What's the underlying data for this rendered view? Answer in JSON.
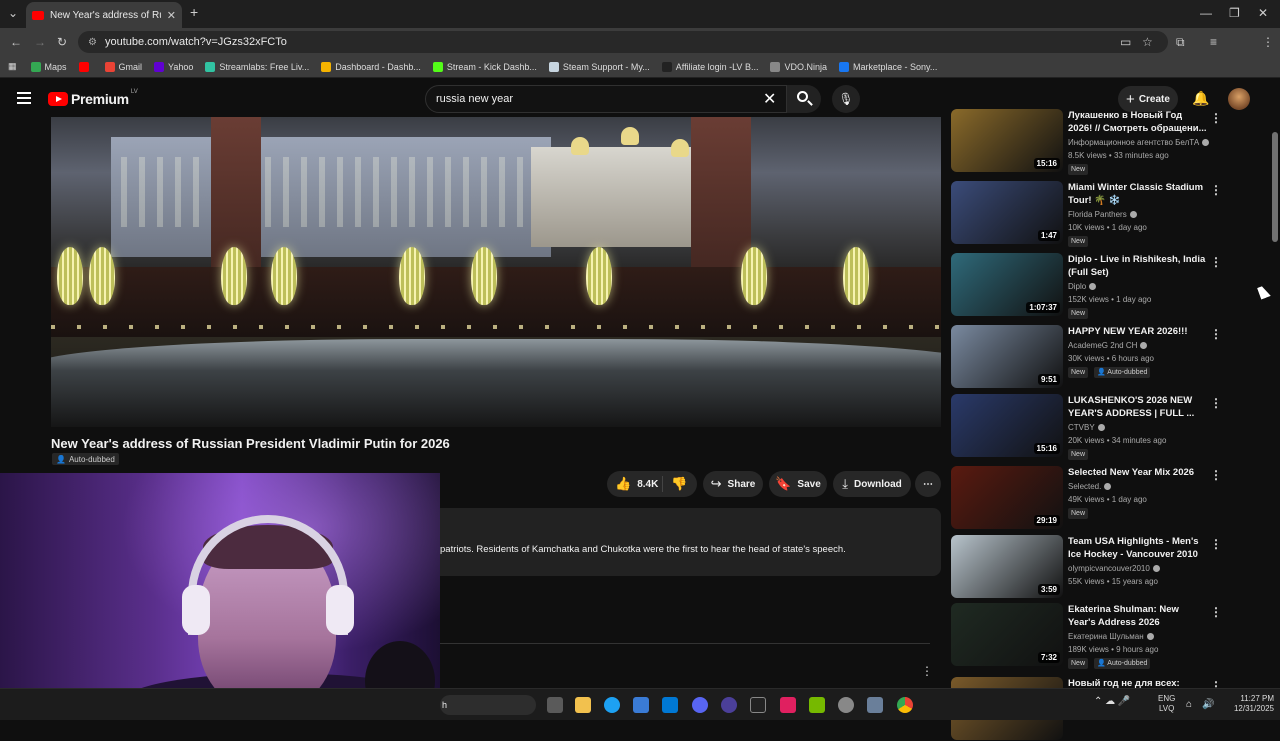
{
  "browser": {
    "tab_title": "New Year's address of Russian P",
    "url": "youtube.com/watch?v=JGzs32xFCTo",
    "bookmarks": [
      {
        "label": "Maps",
        "color": "#34a853"
      },
      {
        "label": "",
        "color": "#ff0000"
      },
      {
        "label": "Gmail",
        "color": "#ea4335"
      },
      {
        "label": "Yahoo",
        "color": "#6001d2"
      },
      {
        "label": "Streamlabs: Free Liv...",
        "color": "#31c3a2"
      },
      {
        "label": "Dashboard - Dashb...",
        "color": "#f5b300"
      },
      {
        "label": "Stream - Kick Dashb...",
        "color": "#53fc18"
      },
      {
        "label": "Steam Support - My...",
        "color": "#c7d5e0"
      },
      {
        "label": "Affiliate login -LV B...",
        "color": "#222222"
      },
      {
        "label": "VDO.Ninja",
        "color": "#888888"
      },
      {
        "label": "Marketplace - Sony...",
        "color": "#1877f2"
      }
    ]
  },
  "youtube": {
    "logo_text": "Premium",
    "country_code": "LV",
    "search_value": "russia new year",
    "create_label": "Create"
  },
  "video": {
    "title": "New Year's address of Russian President Vladimir Putin for 2026",
    "dub_label": "Auto-dubbed",
    "likes": "8.4K",
    "share_label": "Share",
    "save_label": "Save",
    "download_label": "Download",
    "description_snippet": "patriots. Residents of Kamchatka and Chukotka were the first to hear the head of state's speech."
  },
  "recommendations": [
    {
      "title": "Лукашенко в Новый Год 2026! // Смотреть обращени...",
      "channel": "Информационное агентство БелТА",
      "verified": true,
      "views": "8.5K views",
      "age": "33 minutes ago",
      "badge": "New",
      "badge2": "",
      "duration": "15:16",
      "thumb": "#8a6a2a"
    },
    {
      "title": "Miami Winter Classic Stadium Tour! 🌴 ❄️",
      "channel": "Florida Panthers",
      "verified": true,
      "views": "10K views",
      "age": "1 day ago",
      "badge": "New",
      "badge2": "",
      "duration": "1:47",
      "thumb": "#3b4c7a"
    },
    {
      "title": "Diplo - Live in Rishikesh, India (Full Set)",
      "channel": "Diplo",
      "verified": true,
      "views": "152K views",
      "age": "1 day ago",
      "badge": "New",
      "badge2": "",
      "duration": "1:07:37",
      "thumb": "#2f6a7a"
    },
    {
      "title": "HAPPY NEW YEAR 2026!!!",
      "channel": "AcademeG 2nd CH",
      "verified": true,
      "views": "30K views",
      "age": "6 hours ago",
      "badge": "New",
      "badge2": "Auto-dubbed",
      "duration": "9:51",
      "thumb": "#7a8aa0"
    },
    {
      "title": "LUKASHENKO'S 2026 NEW YEAR'S ADDRESS | FULL ...",
      "channel": "CTVBY",
      "verified": true,
      "views": "20K views",
      "age": "34 minutes ago",
      "badge": "New",
      "badge2": "",
      "duration": "15:16",
      "thumb": "#2a3a6a"
    },
    {
      "title": "Selected New Year Mix 2026",
      "channel": "Selected.",
      "verified": true,
      "views": "49K views",
      "age": "1 day ago",
      "badge": "New",
      "badge2": "",
      "duration": "29:19",
      "thumb": "#5a1a10"
    },
    {
      "title": "Team USA Highlights - Men's Ice Hockey - Vancouver 2010 ...",
      "channel": "olympicvancouver2010",
      "verified": true,
      "views": "55K views",
      "age": "15 years ago",
      "badge": "",
      "badge2": "",
      "duration": "3:59",
      "thumb": "#b8c4cc"
    },
    {
      "title": "Ekaterina Shulman: New Year's Address 2026",
      "channel": "Екатерина Шульман",
      "verified": true,
      "views": "189K views",
      "age": "9 hours ago",
      "badge": "New",
      "badge2": "Auto-dubbed",
      "duration": "7:32",
      "thumb": "#1f2a22"
    },
    {
      "title": "Новый год не для всех:",
      "channel": "",
      "verified": false,
      "views": "",
      "age": "",
      "badge": "",
      "badge2": "",
      "duration": "",
      "thumb": "#7a5a2a"
    }
  ],
  "taskbar": {
    "lang_line1": "ENG",
    "lang_line2": "LVQ",
    "time": "11:27 PM",
    "date": "12/31/2025",
    "search_stub": "h"
  }
}
